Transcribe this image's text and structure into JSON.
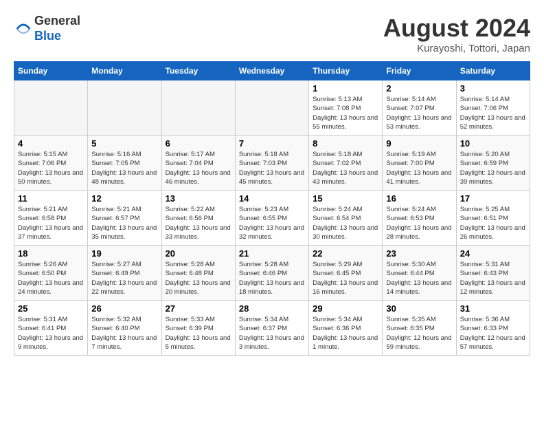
{
  "header": {
    "logo_line1": "General",
    "logo_line2": "Blue",
    "month_title": "August 2024",
    "location": "Kurayoshi, Tottori, Japan"
  },
  "weekdays": [
    "Sunday",
    "Monday",
    "Tuesday",
    "Wednesday",
    "Thursday",
    "Friday",
    "Saturday"
  ],
  "weeks": [
    [
      {
        "day": "",
        "empty": true
      },
      {
        "day": "",
        "empty": true
      },
      {
        "day": "",
        "empty": true
      },
      {
        "day": "",
        "empty": true
      },
      {
        "day": "1",
        "sunrise": "5:13 AM",
        "sunset": "7:08 PM",
        "daylight": "13 hours and 55 minutes."
      },
      {
        "day": "2",
        "sunrise": "5:14 AM",
        "sunset": "7:07 PM",
        "daylight": "13 hours and 53 minutes."
      },
      {
        "day": "3",
        "sunrise": "5:14 AM",
        "sunset": "7:06 PM",
        "daylight": "13 hours and 52 minutes."
      }
    ],
    [
      {
        "day": "4",
        "sunrise": "5:15 AM",
        "sunset": "7:06 PM",
        "daylight": "13 hours and 50 minutes."
      },
      {
        "day": "5",
        "sunrise": "5:16 AM",
        "sunset": "7:05 PM",
        "daylight": "13 hours and 48 minutes."
      },
      {
        "day": "6",
        "sunrise": "5:17 AM",
        "sunset": "7:04 PM",
        "daylight": "13 hours and 46 minutes."
      },
      {
        "day": "7",
        "sunrise": "5:18 AM",
        "sunset": "7:03 PM",
        "daylight": "13 hours and 45 minutes."
      },
      {
        "day": "8",
        "sunrise": "5:18 AM",
        "sunset": "7:02 PM",
        "daylight": "13 hours and 43 minutes."
      },
      {
        "day": "9",
        "sunrise": "5:19 AM",
        "sunset": "7:00 PM",
        "daylight": "13 hours and 41 minutes."
      },
      {
        "day": "10",
        "sunrise": "5:20 AM",
        "sunset": "6:59 PM",
        "daylight": "13 hours and 39 minutes."
      }
    ],
    [
      {
        "day": "11",
        "sunrise": "5:21 AM",
        "sunset": "6:58 PM",
        "daylight": "13 hours and 37 minutes."
      },
      {
        "day": "12",
        "sunrise": "5:21 AM",
        "sunset": "6:57 PM",
        "daylight": "13 hours and 35 minutes."
      },
      {
        "day": "13",
        "sunrise": "5:22 AM",
        "sunset": "6:56 PM",
        "daylight": "13 hours and 33 minutes."
      },
      {
        "day": "14",
        "sunrise": "5:23 AM",
        "sunset": "6:55 PM",
        "daylight": "13 hours and 32 minutes."
      },
      {
        "day": "15",
        "sunrise": "5:24 AM",
        "sunset": "6:54 PM",
        "daylight": "13 hours and 30 minutes."
      },
      {
        "day": "16",
        "sunrise": "5:24 AM",
        "sunset": "6:53 PM",
        "daylight": "13 hours and 28 minutes."
      },
      {
        "day": "17",
        "sunrise": "5:25 AM",
        "sunset": "6:51 PM",
        "daylight": "13 hours and 26 minutes."
      }
    ],
    [
      {
        "day": "18",
        "sunrise": "5:26 AM",
        "sunset": "6:50 PM",
        "daylight": "13 hours and 24 minutes."
      },
      {
        "day": "19",
        "sunrise": "5:27 AM",
        "sunset": "6:49 PM",
        "daylight": "13 hours and 22 minutes."
      },
      {
        "day": "20",
        "sunrise": "5:28 AM",
        "sunset": "6:48 PM",
        "daylight": "13 hours and 20 minutes."
      },
      {
        "day": "21",
        "sunrise": "5:28 AM",
        "sunset": "6:46 PM",
        "daylight": "13 hours and 18 minutes."
      },
      {
        "day": "22",
        "sunrise": "5:29 AM",
        "sunset": "6:45 PM",
        "daylight": "13 hours and 16 minutes."
      },
      {
        "day": "23",
        "sunrise": "5:30 AM",
        "sunset": "6:44 PM",
        "daylight": "13 hours and 14 minutes."
      },
      {
        "day": "24",
        "sunrise": "5:31 AM",
        "sunset": "6:43 PM",
        "daylight": "13 hours and 12 minutes."
      }
    ],
    [
      {
        "day": "25",
        "sunrise": "5:31 AM",
        "sunset": "6:41 PM",
        "daylight": "13 hours and 9 minutes."
      },
      {
        "day": "26",
        "sunrise": "5:32 AM",
        "sunset": "6:40 PM",
        "daylight": "13 hours and 7 minutes."
      },
      {
        "day": "27",
        "sunrise": "5:33 AM",
        "sunset": "6:39 PM",
        "daylight": "13 hours and 5 minutes."
      },
      {
        "day": "28",
        "sunrise": "5:34 AM",
        "sunset": "6:37 PM",
        "daylight": "13 hours and 3 minutes."
      },
      {
        "day": "29",
        "sunrise": "5:34 AM",
        "sunset": "6:36 PM",
        "daylight": "13 hours and 1 minute."
      },
      {
        "day": "30",
        "sunrise": "5:35 AM",
        "sunset": "6:35 PM",
        "daylight": "12 hours and 59 minutes."
      },
      {
        "day": "31",
        "sunrise": "5:36 AM",
        "sunset": "6:33 PM",
        "daylight": "12 hours and 57 minutes."
      }
    ]
  ]
}
